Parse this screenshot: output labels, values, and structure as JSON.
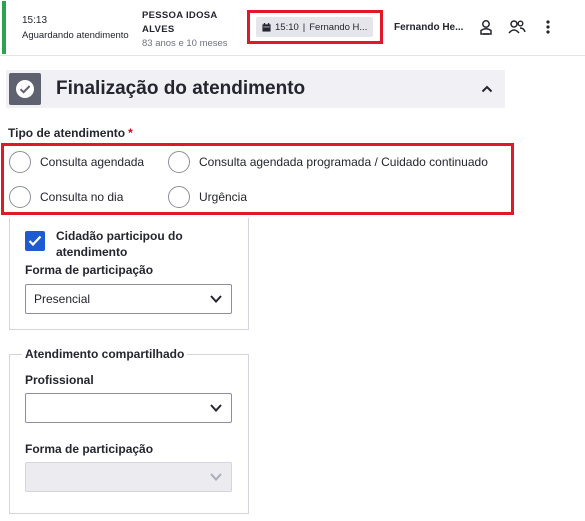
{
  "patient_row": {
    "time": "15:13",
    "status": "Aguardando atendimento",
    "name_line1": "PESSOA IDOSA",
    "name_line2": "ALVES",
    "age": "83 anos e 10 meses",
    "schedule_time": "15:10",
    "schedule_separator": "|",
    "schedule_professional": "Fernando H...",
    "professional": "Fernando He...",
    "status_color": "#2ea34f",
    "icons": [
      "doctor-icon",
      "people-icon",
      "more-vertical-icon"
    ]
  },
  "section": {
    "title": "Finalização do atendimento",
    "icon": "check-circle-icon",
    "collapse_icon": "chevron-up-icon"
  },
  "tipo_atendimento": {
    "label": "Tipo de atendimento",
    "required_mark": "*",
    "options": [
      {
        "label": "Consulta agendada",
        "selected": false
      },
      {
        "label": "Consulta agendada programada / Cuidado continuado",
        "selected": false
      },
      {
        "label": "Consulta no dia",
        "selected": false
      },
      {
        "label": "Urgência",
        "selected": false
      }
    ]
  },
  "participacao": {
    "checkbox_label_line1": "Cidadão participou do",
    "checkbox_label_line2": "atendimento",
    "checked": true,
    "forma_label": "Forma de participação",
    "forma_value": "Presencial"
  },
  "compartilhado": {
    "title": "Atendimento compartilhado",
    "profissional_label": "Profissional",
    "profissional_value": "",
    "forma_label": "Forma de participação",
    "forma_value": ""
  },
  "colors": {
    "highlight": "#e2182a",
    "checkbox": "#1e5bd1",
    "header_bg": "#f0f0f5",
    "required": "#d0021b"
  }
}
